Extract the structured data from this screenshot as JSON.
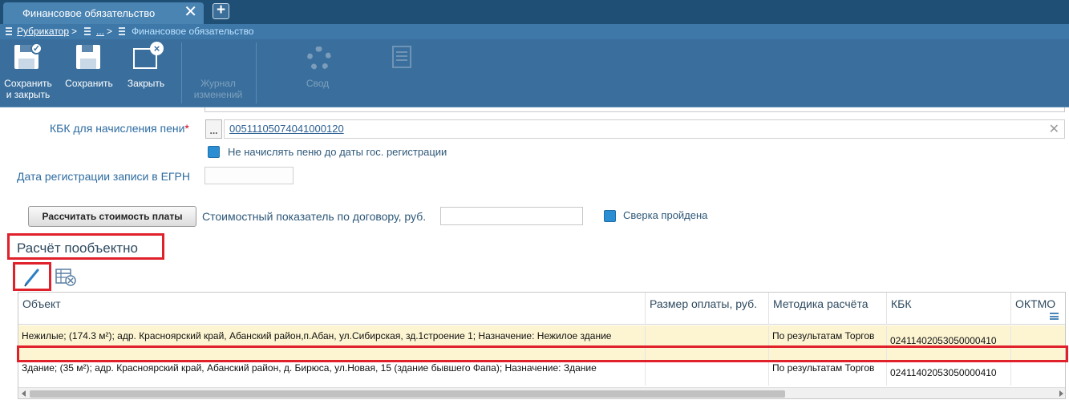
{
  "tab": {
    "title": "Финансовое обязательство"
  },
  "breadcrumb": {
    "root": "Рубрикатор",
    "sep": ">",
    "middle": "...",
    "current": "Финансовое обязательство"
  },
  "toolbar": {
    "save_close_line1": "Сохранить",
    "save_close_line2": "и закрыть",
    "save": "Сохранить",
    "close": "Закрыть",
    "journal_line1": "Журнал",
    "journal_line2": "изменений",
    "summary": "Свод"
  },
  "form": {
    "kbk_penalty_label": "КБК для начисления пени",
    "required_mark": "*",
    "kbk_penalty_value": "00511105074041000120",
    "no_penalty_checkbox": "Не начислять пеню до даты гос. регистрации",
    "egrn_date_label": "Дата регистрации записи в ЕГРН",
    "egrn_date_value": "",
    "calc_button": "Рассчитать стоимость платы",
    "cost_label": "Стоимостный показатель по договору, руб.",
    "cost_value": "",
    "reconciled_checkbox": "Сверка пройдена"
  },
  "section": {
    "title": "Расчёт пообъектно"
  },
  "grid": {
    "columns": [
      "Объект",
      "Размер оплаты, руб.",
      "Методика расчёта",
      "КБК",
      "ОКТМО"
    ],
    "rows": [
      {
        "object": "Нежилые; (174.3 м²); адр. Красноярский край, Абанский район,п.Абан, ул.Сибирская, зд.1строение 1; Назначение: Нежилое здание",
        "payment": "",
        "method": "По результатам Торгов",
        "kbk": "02411402053050000410",
        "oktmo": ""
      },
      {
        "object": "Здание; (35 м²); адр. Красноярский край, Абанский район, д. Бирюса, ул.Новая, 15 (здание бывшего Фапа); Назначение: Здание",
        "payment": "",
        "method": "По результатам Торгов",
        "kbk": "02411402053050000410",
        "oktmo": ""
      }
    ]
  },
  "colors": {
    "tabbar": "#1f4f74",
    "toolbar": "#3a6f9d",
    "highlight": "#e0202a",
    "selected_row": "#fdf5d2"
  }
}
